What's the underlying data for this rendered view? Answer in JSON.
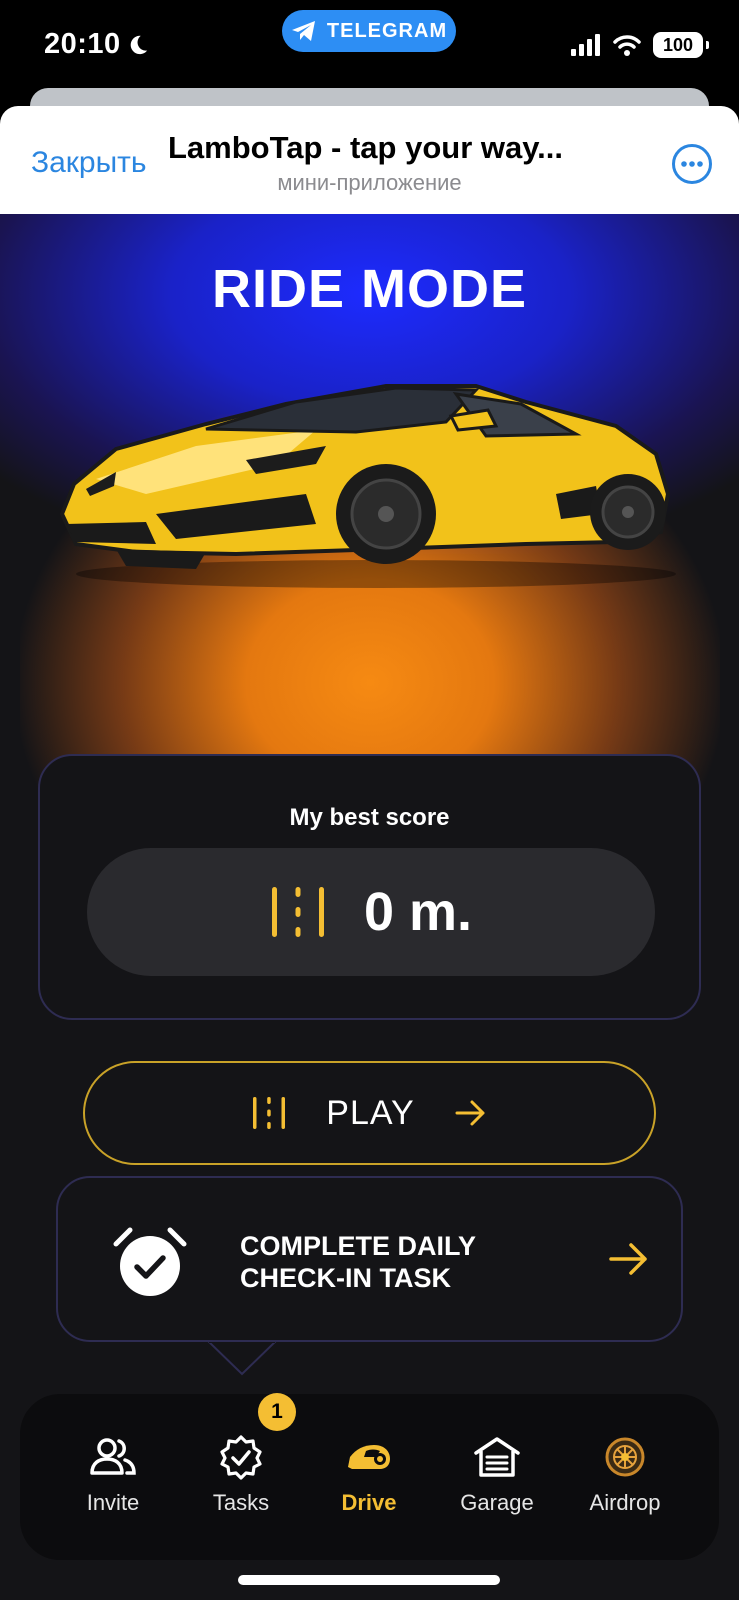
{
  "status_bar": {
    "time": "20:10",
    "pill_label": "TELEGRAM",
    "battery": "100"
  },
  "header": {
    "close_label": "Закрыть",
    "title": "LamboTap - tap your way...",
    "subtitle": "мини-приложение",
    "more_icon": "more-dots-icon"
  },
  "hero": {
    "title": "RIDE MODE",
    "image": "yellow-sports-car"
  },
  "score": {
    "label": "My best score",
    "value": "0 m.",
    "icon": "road-lines-icon"
  },
  "play": {
    "label": "PLAY",
    "icon": "road-lines-icon",
    "arrow": "arrow-right-icon"
  },
  "daily": {
    "line1": "COMPLETE DAILY",
    "line2": "CHECK-IN TASK",
    "icon": "alarm-clock-check-icon"
  },
  "nav": {
    "items": [
      {
        "label": "Invite",
        "icon": "users-icon"
      },
      {
        "label": "Tasks",
        "icon": "badge-check-icon",
        "badge": "1"
      },
      {
        "label": "Drive",
        "icon": "car-icon",
        "active": true
      },
      {
        "label": "Garage",
        "icon": "garage-icon"
      },
      {
        "label": "Airdrop",
        "icon": "coin-icon"
      }
    ]
  },
  "colors": {
    "accent_yellow": "#f4be33",
    "telegram_blue": "#2d8ef4",
    "link_blue": "#2b86e0",
    "background": "#141417",
    "card_border": "#2e2c52"
  }
}
